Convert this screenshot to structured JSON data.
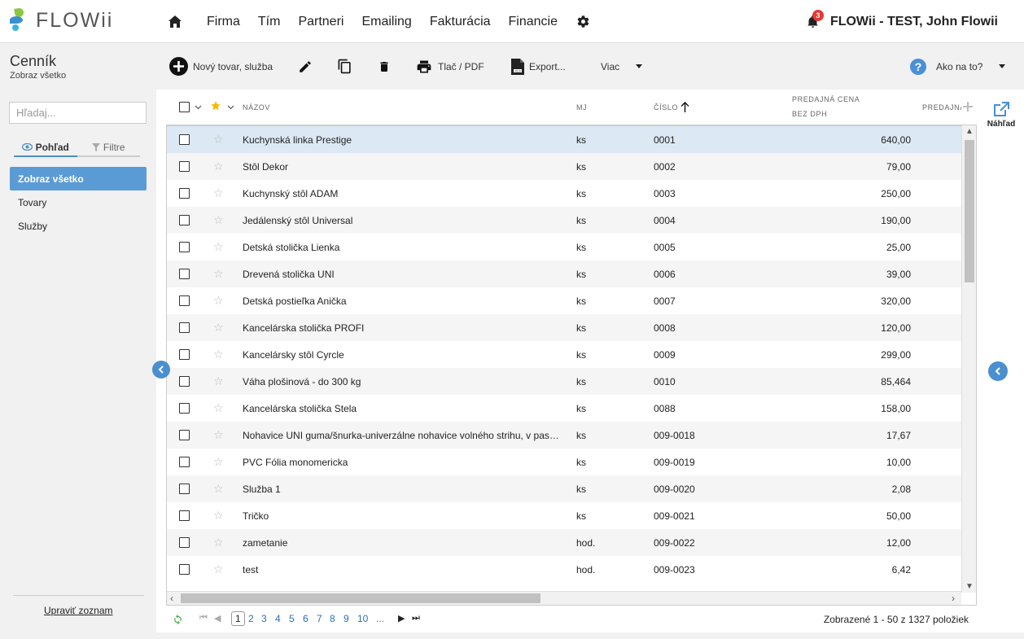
{
  "app": {
    "logo_text": "FLOWii"
  },
  "nav": {
    "items": [
      "Firma",
      "Tím",
      "Partneri",
      "Emailing",
      "Fakturácia",
      "Financie"
    ],
    "notification_count": "3",
    "user": "FLOWii - TEST, John Flowii"
  },
  "sidebar": {
    "title": "Cenník",
    "subtitle": "Zobraz všetko",
    "search_placeholder": "Hľadaj...",
    "tabs": {
      "view": "Pohľad",
      "filters": "Filtre"
    },
    "menu": [
      "Zobraz všetko",
      "Tovary",
      "Služby"
    ],
    "edit_link": "Upraviť zoznam"
  },
  "toolbar": {
    "new_item": "Nový tovar, služba",
    "print": "Tlač / PDF",
    "export": "Export...",
    "more": "Viac",
    "help": "Ako na to?",
    "help_glyph": "?"
  },
  "table": {
    "headers": {
      "name": "Názov",
      "unit": "MJ",
      "number": "Číslo",
      "price_line1": "Predajná cena",
      "price_line2": "bez DPH",
      "price_next": "Predajná"
    },
    "rows": [
      {
        "name": "Kuchynská linka Prestige",
        "unit": "ks",
        "number": "0001",
        "price": "640,00"
      },
      {
        "name": "Stôl Dekor",
        "unit": "ks",
        "number": "0002",
        "price": "79,00"
      },
      {
        "name": "Kuchynský stôl ADAM",
        "unit": "ks",
        "number": "0003",
        "price": "250,00"
      },
      {
        "name": "Jedálenský stôl Universal",
        "unit": "ks",
        "number": "0004",
        "price": "190,00"
      },
      {
        "name": "Detská stolička Lienka",
        "unit": "ks",
        "number": "0005",
        "price": "25,00"
      },
      {
        "name": "Drevená stolička UNI",
        "unit": "ks",
        "number": "0006",
        "price": "39,00"
      },
      {
        "name": "Detská postieľka Anička",
        "unit": "ks",
        "number": "0007",
        "price": "320,00"
      },
      {
        "name": "Kancelárska stolička PROFI",
        "unit": "ks",
        "number": "0008",
        "price": "120,00"
      },
      {
        "name": "Kancelársky stôl Cyrcle",
        "unit": "ks",
        "number": "0009",
        "price": "299,00"
      },
      {
        "name": "Váha plošinová - do 300 kg",
        "unit": "ks",
        "number": "0010",
        "price": "85,464"
      },
      {
        "name": "Kancelárska stolička Stela",
        "unit": "ks",
        "number": "0088",
        "price": "158,00"
      },
      {
        "name": "Nohavice UNI guma/šnurka-univerzálne nohavice volného strihu, v pase gumené",
        "unit": "ks",
        "number": "009-0018",
        "price": "17,67"
      },
      {
        "name": "PVC Fólia monomericka",
        "unit": "ks",
        "number": "009-0019",
        "price": "10,00"
      },
      {
        "name": "Služba 1",
        "unit": "ks",
        "number": "009-0020",
        "price": "2,08"
      },
      {
        "name": "Tričko",
        "unit": "ks",
        "number": "009-0021",
        "price": "50,00"
      },
      {
        "name": "zametanie",
        "unit": "hod.",
        "number": "009-0022",
        "price": "12,00"
      },
      {
        "name": "test",
        "unit": "hod.",
        "number": "009-0023",
        "price": "6,42"
      }
    ]
  },
  "pager": {
    "pages": [
      "1",
      "2",
      "3",
      "4",
      "5",
      "6",
      "7",
      "8",
      "9",
      "10",
      "..."
    ],
    "current": "1",
    "info": "Zobrazené 1 - 50 z 1327 položiek"
  },
  "preview": {
    "label": "Náhľad"
  },
  "colors": {
    "accent": "#5b9bd5",
    "selected_row": "#dce8f3",
    "badge": "#e53935"
  }
}
